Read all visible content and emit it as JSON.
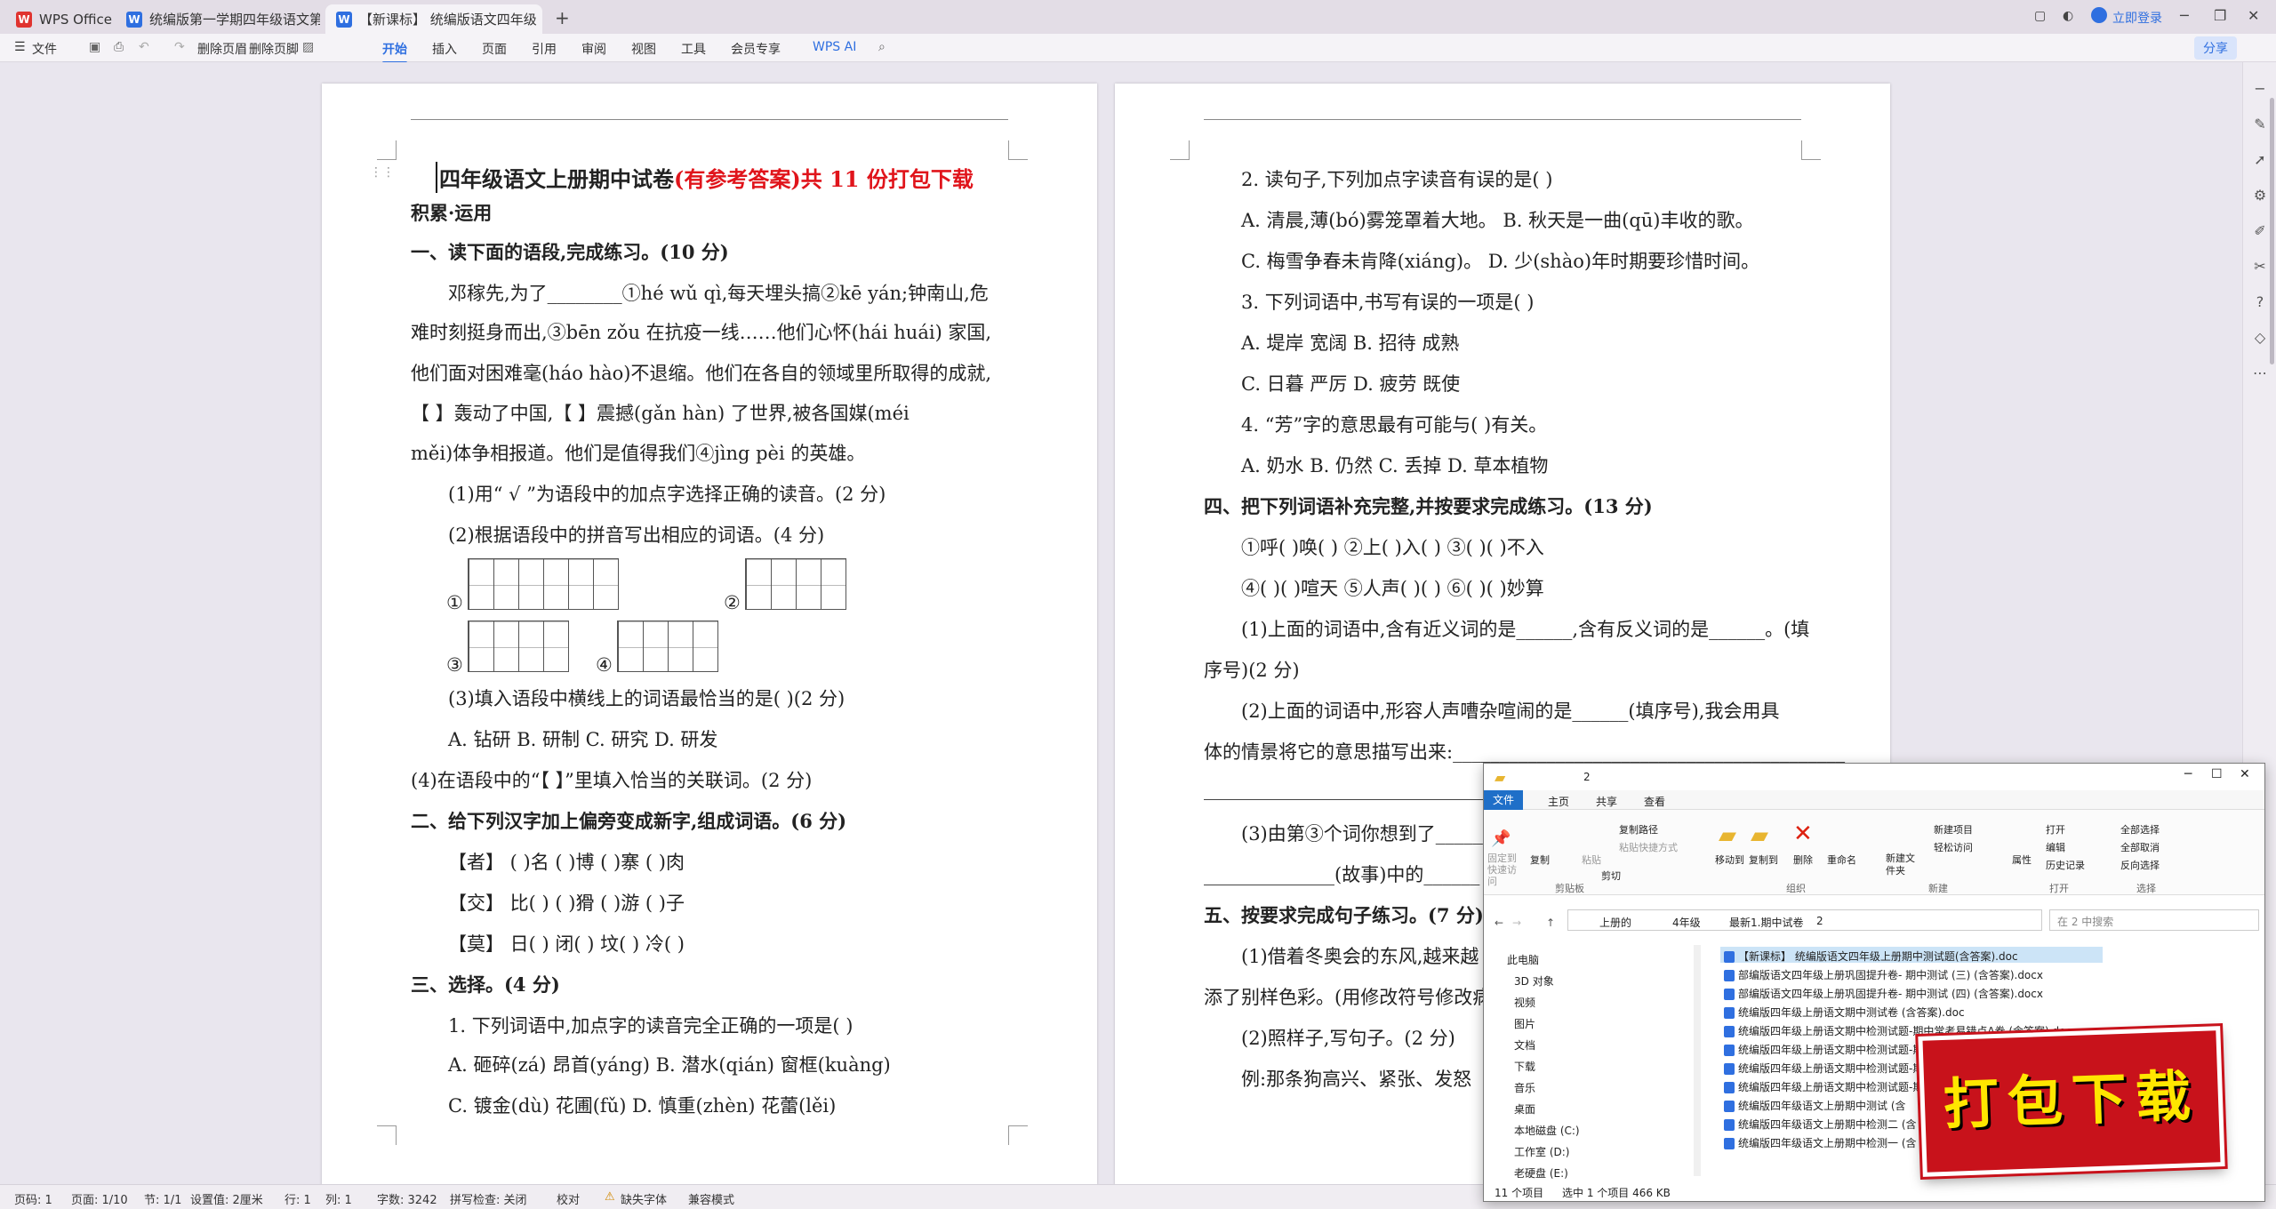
{
  "tabs": [
    {
      "label": "WPS Office",
      "icon": "W"
    },
    {
      "label": "统编版第一学期四年级语文第一次月考",
      "icon": "W"
    },
    {
      "label": "【新课标】 统编版语文四年级",
      "icon": "W"
    }
  ],
  "titlebar": {
    "login": "立即登录",
    "new_tab": "+"
  },
  "ribbon": {
    "file_menu": "文件",
    "delete_header": "删除页眉",
    "delete_footer": "删除页脚",
    "menus": [
      "开始",
      "插入",
      "页面",
      "引用",
      "审阅",
      "视图",
      "工具",
      "会员专享"
    ],
    "ai": "WPS AI",
    "share": "分享"
  },
  "page1": {
    "title_black": "四年级语文上册期中试卷",
    "title_red": "(有参考答案)共 11 份打包下载",
    "section_label": "积累·运用",
    "lines": [
      "一、读下面的语段,完成练习。(10 分)",
      "邓稼先,为了________①hé wǔ qì,每天埋头搞②kē yán;钟南山,危",
      "难时刻挺身而出,③bēn zǒu 在抗疫一线……他们心怀(hái   huái) 家国,",
      "他们面对困难毫(háo     hào)不退缩。他们在各自的领域里所取得的成就,",
      "【        】轰动了中国,【        】震撼(gǎn   hàn) 了世界,被各国媒(méi",
      "měi)体争相报道。他们是值得我们④jìng pèi 的英雄。",
      "(1)用“ √ ”为语段中的加点字选择正确的读音。(2 分)",
      "(2)根据语段中的拼音写出相应的词语。(4 分)",
      "(3)填入语段中横线上的词语最恰当的是(      )(2 分)",
      "A. 钻研      B. 研制        C. 研究        D. 研发",
      "(4)在语段中的“【        】”里填入恰当的关联词。(2 分)",
      "二、给下列汉字加上偏旁变成新字,组成词语。(6 分)",
      "【者】    (      )名       (      )博       (      )寨       (      )肉",
      "【交】    比(      )       (      )猾       (      )游       (      )子",
      "【莫】    日(      )       闭(      )       坟(      )       冷(      )",
      "三、选择。(4 分)",
      "1. 下列词语中,加点字的读音完全正确的一项是(      )",
      "A. 砸碎(zá)    昂首(yáng)   B. 潜水(qián)    窗框(kuàng)",
      "C. 镀金(dù)    花圃(fǔ)   D. 慎重(zhèn)    花蕾(lěi)"
    ],
    "grid_labels": [
      "①",
      "②",
      "③",
      "④"
    ]
  },
  "page2": {
    "lines": [
      "2. 读句子,下列加点字读音有误的是(      )",
      "A. 清晨,薄(bó)雾笼罩着大地。     B. 秋天是一曲(qū)丰收的歌。",
      "C. 梅雪争春未肯降(xiáng)。          D. 少(shào)年时期要珍惜时间。",
      "3. 下列词语中,书写有误的一项是(      )",
      "A. 堤岸    宽阔          B. 招待    成熟",
      "C. 日暮    严厉          D. 疲劳    既使",
      "4. “芳”字的意思最有可能与(      )有关。",
      "A. 奶水       B. 仍然       C. 丢掉       D. 草本植物",
      "四、把下列词语补充完整,并按要求完成练习。(13 分)",
      "①呼(      )唤(      )       ②上(      )入(      )       ③(      )(      )不入",
      "④(      )(      )喧天       ⑤人声(      )(      )       ⑥(      )(      )妙算",
      "(1)上面的词语中,含有近义词的是______,含有反义词的是______。(填",
      "序号)(2 分)",
      "(2)上面的词语中,形容人声嘈杂喧闹的是______(填序号),我会用具",
      "体的情景将它的意思描写出来:__________________________________________",
      "______________________________________________________________",
      "(3)由第③个词你想到了______",
      "______________(故事)中的______",
      "五、按要求完成句子练习。(7 分)",
      "(1)借着冬奥会的东风,越来越",
      "添了别样色彩。(用修改符号修改病",
      "(2)照样子,写句子。(2 分)",
      "例:那条狗高兴、紧张、发怒"
    ]
  },
  "explorer": {
    "title": "2",
    "tabs": [
      "文件",
      "主页",
      "共享",
      "查看"
    ],
    "groups": [
      "剪贴板",
      "组织",
      "新建",
      "打开",
      "选择"
    ],
    "actions": [
      "固定到快速访问",
      "复制",
      "粘贴",
      "复制路径",
      "粘贴快捷方式",
      "剪切",
      "移动到",
      "复制到",
      "删除",
      "重命名",
      "新建文件夹",
      "新建项目",
      "轻松访问",
      "属性",
      "打开",
      "编辑",
      "历史记录",
      "全部选择",
      "全部取消",
      "反向选择"
    ],
    "breadcrumb": [
      "上册的",
      "4年级",
      "最新1.期中试卷",
      "2"
    ],
    "search_placeholder": "在 2 中搜索",
    "nav": [
      "此电脑",
      "3D 对象",
      "视频",
      "图片",
      "文档",
      "下载",
      "音乐",
      "桌面",
      "本地磁盘 (C:)",
      "工作室 (D:)",
      "老硬盘 (E:)"
    ],
    "files": [
      "【新课标】 统编版语文四年级上册期中测试题(含答案).doc",
      "部编版语文四年级上册巩固提升卷- 期中测试 (三) (含答案).docx",
      "部编版语文四年级上册巩固提升卷- 期中测试 (四) (含答案).docx",
      "统编版四年级上册语文期中测试卷 (含答案).doc",
      "统编版四年级上册语文期中检测试题-期中常考易错点A卷 (含答案).docx",
      "统编版四年级上册语文期中检测试题-期中常考",
      "统编版四年级上册语文期中检测试题-期中常考",
      "统编版四年级上册语文期中检测试题-期中常考",
      "统编版四年级语文上册期中测试 (含",
      "统编版四年级语文上册期中检测二 (含",
      "统编版四年级语文上册期中检测一 (含"
    ],
    "status": [
      "11 个项目",
      "选中 1 个项目 466 KB"
    ]
  },
  "promo": "打包下载",
  "statusbar": [
    "页码: 1",
    "页面: 1/10",
    "节: 1/1",
    "设置值: 2厘米",
    "行: 1",
    "列: 1",
    "字数: 3242",
    "拼写检查: 关闭",
    "校对",
    "缺失字体",
    "兼容模式"
  ]
}
